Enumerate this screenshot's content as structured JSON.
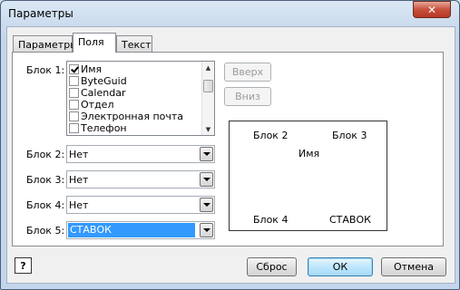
{
  "window": {
    "title": "Параметры",
    "close_glyph": "✕"
  },
  "tabs": [
    {
      "label": "Параметры",
      "active": false
    },
    {
      "label": "Поля",
      "active": true
    },
    {
      "label": "Текст",
      "active": false
    }
  ],
  "block1": {
    "label": "Блок 1:",
    "items": [
      {
        "label": "Имя",
        "checked": true
      },
      {
        "label": "ByteGuid",
        "checked": false
      },
      {
        "label": "Calendar",
        "checked": false
      },
      {
        "label": "Отдел",
        "checked": false
      },
      {
        "label": "Электронная почта",
        "checked": false
      },
      {
        "label": "Телефон",
        "checked": false
      }
    ]
  },
  "move_up_button": "Вверх",
  "move_down_button": "Вниз",
  "block2": {
    "label": "Блок 2:",
    "value": "Нет"
  },
  "block3": {
    "label": "Блок 3:",
    "value": "Нет"
  },
  "block4": {
    "label": "Блок 4:",
    "value": "Нет"
  },
  "block5": {
    "label": "Блок 5:",
    "value": "СТАВОК"
  },
  "preview": {
    "block2": "Блок 2",
    "block3": "Блок 3",
    "center": "Имя",
    "block4": "Блок 4",
    "block5": "СТАВОК"
  },
  "footer": {
    "help_glyph": "?",
    "reset_button": "Сброс",
    "ok_button": "ОК",
    "cancel_button": "Отмена"
  },
  "colors": {
    "selection": "#3399ff",
    "close": "#c7503b",
    "default_button": "#3c7fb1"
  }
}
